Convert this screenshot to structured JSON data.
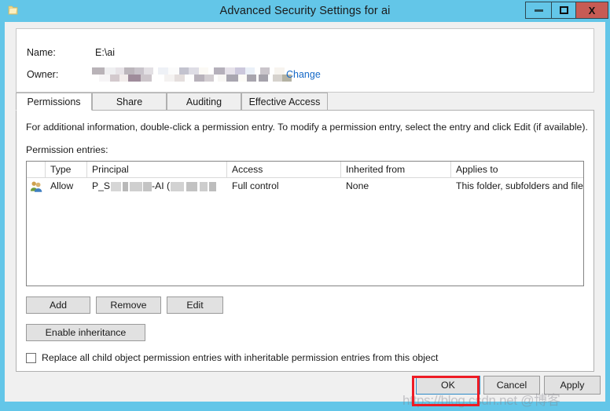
{
  "window": {
    "title": "Advanced Security Settings for ai",
    "icon": "folder-icon",
    "caption_buttons": {
      "minimize": "",
      "maximize": "",
      "close": "X"
    },
    "titlebar_color": "#63c6e8",
    "close_button_color": "#c75b54"
  },
  "header": {
    "name_label": "Name:",
    "name_value": "E:\\ai",
    "owner_label": "Owner:",
    "owner_value": "",
    "change_link": "Change",
    "link_color": "#1569c7"
  },
  "tabs": [
    {
      "label": "Permissions",
      "active": true
    },
    {
      "label": "Share",
      "active": false
    },
    {
      "label": "Auditing",
      "active": false
    },
    {
      "label": "Effective Access",
      "active": false
    }
  ],
  "permissions_page": {
    "info_text": "For additional information, double-click a permission entry. To modify a permission entry, select the entry and click Edit (if available).",
    "entries_label": "Permission entries:",
    "columns": [
      "",
      "Type",
      "Principal",
      "Access",
      "Inherited from",
      "Applies to"
    ],
    "rows": [
      {
        "icon": "users-group-icon",
        "type": "Allow",
        "principal": "P_S█████-AI (██████)",
        "access": "Full control",
        "inherited_from": "None",
        "applies_to": "This folder, subfolders and files"
      }
    ],
    "buttons": {
      "add": "Add",
      "remove": "Remove",
      "edit": "Edit",
      "enable_inheritance": "Enable inheritance"
    },
    "replace_checkbox": {
      "label": "Replace all child object permission entries with inheritable permission entries from this object",
      "checked": false
    }
  },
  "footer": {
    "ok": "OK",
    "cancel": "Cancel",
    "apply": "Apply"
  },
  "annotation": {
    "highlight_color": "#ee1b24",
    "target": "OK"
  },
  "watermark": {
    "text": "https://blog.csdn.net @博客"
  }
}
